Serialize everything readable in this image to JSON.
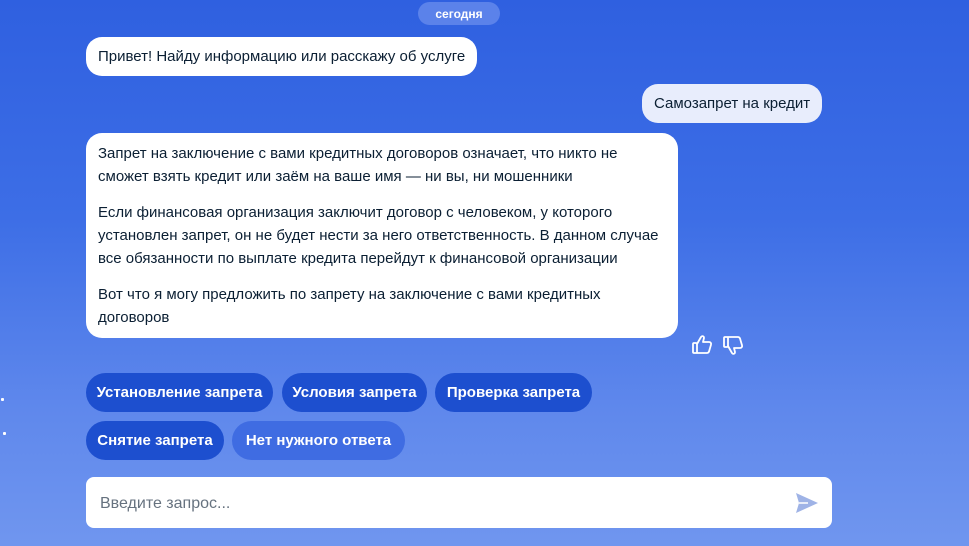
{
  "chat": {
    "date_label": "сегодня",
    "greeting": "Привет! Найду информацию или расскажу об услуге",
    "user_message": "Самозапрет на кредит",
    "answer": {
      "p1": "Запрет на заключение с вами кредитных договоров означает, что никто не сможет взять кредит или заём на ваше имя — ни вы, ни мошенники",
      "p2": "Если финансовая организация заключит договор с человеком, у которого установлен запрет, он не будет нести за него ответственность. В данном случае все обязанности по выплате кредита перейдут к финансовой организации",
      "p3": "Вот что я могу предложить по запрету на заключение с вами кредитных договоров"
    },
    "feedback": {
      "like_icon": "thumbs-up-icon",
      "dislike_icon": "thumbs-down-icon"
    }
  },
  "suggestions": [
    "Установление запрета",
    "Условия запрета",
    "Проверка запрета",
    "Снятие запрета",
    "Нет нужного ответа"
  ],
  "input": {
    "placeholder": "Введите запрос...",
    "value": "",
    "send_icon": "send-icon"
  },
  "colors": {
    "accent": "#1d4fcf",
    "background": "#3d6ee6",
    "user_bubble": "#e8edfc"
  }
}
